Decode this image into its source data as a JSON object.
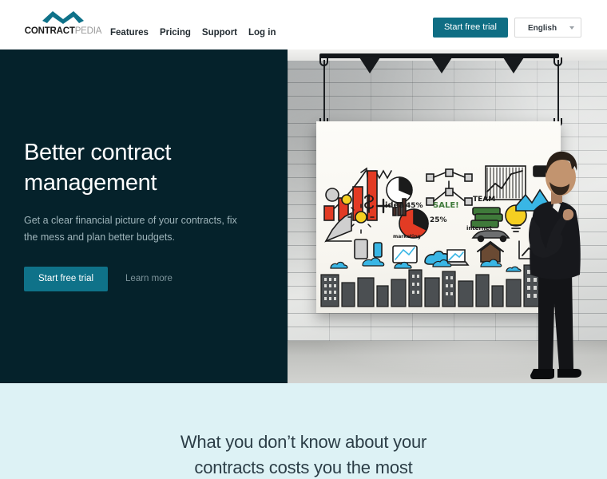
{
  "header": {
    "logo": {
      "mark_name": "contractpedia-wave-logo",
      "bold_text": "CONTRACT",
      "light_text": "PEDIA",
      "mark_color": "#0f7289"
    },
    "nav": [
      {
        "label": "Features",
        "name": "nav-link-features"
      },
      {
        "label": "Pricing",
        "name": "nav-link-pricing"
      },
      {
        "label": "Support",
        "name": "nav-link-support"
      },
      {
        "label": "Log in",
        "name": "nav-link-login"
      }
    ],
    "trial_button": "Start free trial",
    "language": {
      "selected": "English",
      "caret_icon": "chevron-down-icon"
    }
  },
  "hero": {
    "title_line1": "Better contract",
    "title_line2": "management",
    "subtitle": "Get a clear financial picture of your contracts, fix the mess and plan better budgets.",
    "primary_cta": "Start free trial",
    "secondary_cta": "Learn more",
    "background_color": "#05222b",
    "accent_color": "#0f7289",
    "image": {
      "alt": "Businessman in a dark suit standing in front of a whiteboard covered in colorful business doodles, hung on a white-painted brick wall under track lighting",
      "elements": [
        "track-lighting",
        "brick-wall",
        "concrete-floor",
        "hanging-whiteboard",
        "business-doodles",
        "man-in-suit"
      ]
    }
  },
  "section_two": {
    "heading_line1": "What you don’t know about your",
    "heading_line2": "contracts costs you the most",
    "background_color": "#ddf2f5",
    "text_color": "#2c3e47"
  }
}
